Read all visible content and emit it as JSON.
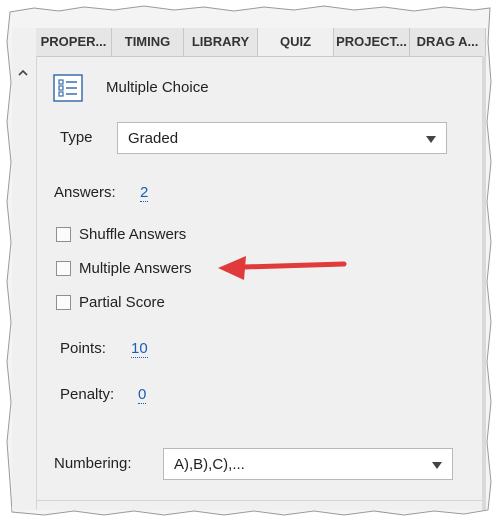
{
  "tabs": [
    {
      "label": "PROPER..."
    },
    {
      "label": "TIMING"
    },
    {
      "label": "LIBRARY"
    },
    {
      "label": "QUIZ"
    },
    {
      "label": "PROJECT..."
    },
    {
      "label": "DRAG A..."
    }
  ],
  "active_tab": "QUIZ",
  "collapse_icon": "chevron-up-icon",
  "question_type": {
    "icon": "multiple-choice-list-icon",
    "title": "Multiple Choice"
  },
  "type_field": {
    "label": "Type",
    "value": "Graded"
  },
  "answers": {
    "label": "Answers:",
    "value": "2"
  },
  "options": [
    {
      "label": "Shuffle Answers",
      "checked": false
    },
    {
      "label": "Multiple Answers",
      "checked": false
    },
    {
      "label": "Partial Score",
      "checked": false
    }
  ],
  "points": {
    "label": "Points:",
    "value": "10"
  },
  "penalty": {
    "label": "Penalty:",
    "value": "0"
  },
  "numbering": {
    "label": "Numbering:",
    "value": "A),B),C),..."
  },
  "annotation_color": "#e03a3a",
  "link_color": "#1a5fb4"
}
